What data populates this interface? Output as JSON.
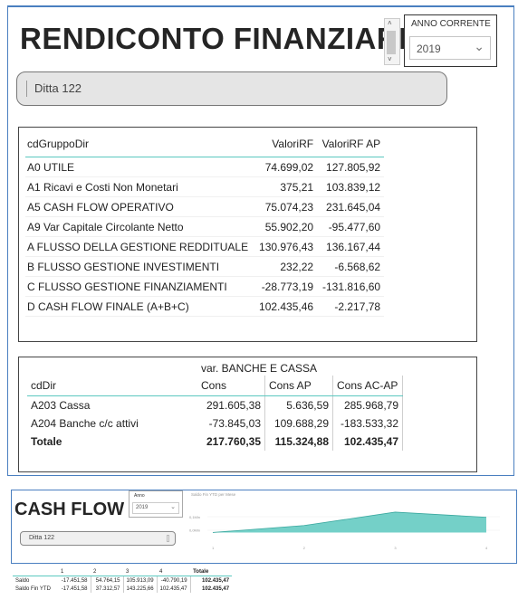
{
  "report": {
    "title": "RENDICONTO FINANZIARIO",
    "year_slicer": {
      "label": "ANNO CORRENTE",
      "value": "2019"
    },
    "company_filter": "Ditta 122"
  },
  "rf_table": {
    "headers": [
      "cdGruppoDir",
      "ValoriRF",
      "ValoriRF AP"
    ],
    "rows": [
      [
        "A0 UTILE",
        "74.699,02",
        "127.805,92"
      ],
      [
        "A1 Ricavi e Costi Non Monetari",
        "375,21",
        "103.839,12"
      ],
      [
        "A5 CASH FLOW OPERATIVO",
        "75.074,23",
        "231.645,04"
      ],
      [
        "A9 Var Capitale Circolante Netto",
        "55.902,20",
        "-95.477,60"
      ],
      [
        "A FLUSSO DELLA GESTIONE REDDITUALE",
        "130.976,43",
        "136.167,44"
      ],
      [
        "B FLUSSO GESTIONE INVESTIMENTI",
        "232,22",
        "-6.568,62"
      ],
      [
        "C FLUSSO GESTIONE FINANZIAMENTI",
        "-28.773,19",
        "-131.816,60"
      ],
      [
        "D CASH FLOW FINALE (A+B+C)",
        "102.435,46",
        "-2.217,78"
      ]
    ]
  },
  "bank_table": {
    "group_header": "var. BANCHE E CASSA",
    "headers": [
      "cdDir",
      "Cons",
      "Cons AP",
      "Cons AC-AP"
    ],
    "rows": [
      [
        "A203 Cassa",
        "291.605,38",
        "5.636,59",
        "285.968,79"
      ],
      [
        "A204 Banche c/c attivi",
        "-73.845,03",
        "109.688,29",
        "-183.533,32"
      ]
    ],
    "total": [
      "Totale",
      "217.760,35",
      "115.324,88",
      "102.435,47"
    ]
  },
  "cash_flow": {
    "title": "CASH FLOW",
    "year_slicer": {
      "label": "Anno",
      "value": "2019"
    },
    "company_filter": "Ditta 122",
    "chart_title": "Saldo Fin YTD per Mese",
    "chart_data": {
      "type": "area",
      "x": [
        1,
        2,
        3,
        4
      ],
      "y": [
        -17451.58,
        37312.57,
        143225.66,
        102435.47
      ],
      "yticks": [
        "0,1Mln",
        "0,0Mln"
      ],
      "xticks": [
        "1",
        "2",
        "3",
        "4"
      ],
      "color": "#5cc8be"
    },
    "table": {
      "headers": [
        "",
        "1",
        "2",
        "3",
        "4",
        "Totale"
      ],
      "rows": [
        [
          "Saldo",
          "-17.451,58",
          "54.764,15",
          "105.913,09",
          "-40.790,19",
          "102.435,47"
        ],
        [
          "Saldo Fin YTD",
          "-17.451,58",
          "37.312,57",
          "143.225,66",
          "102.435,47",
          "102.435,47"
        ]
      ]
    }
  },
  "colors": {
    "accent": "#5cc8be",
    "frame": "#4a7fc0"
  }
}
